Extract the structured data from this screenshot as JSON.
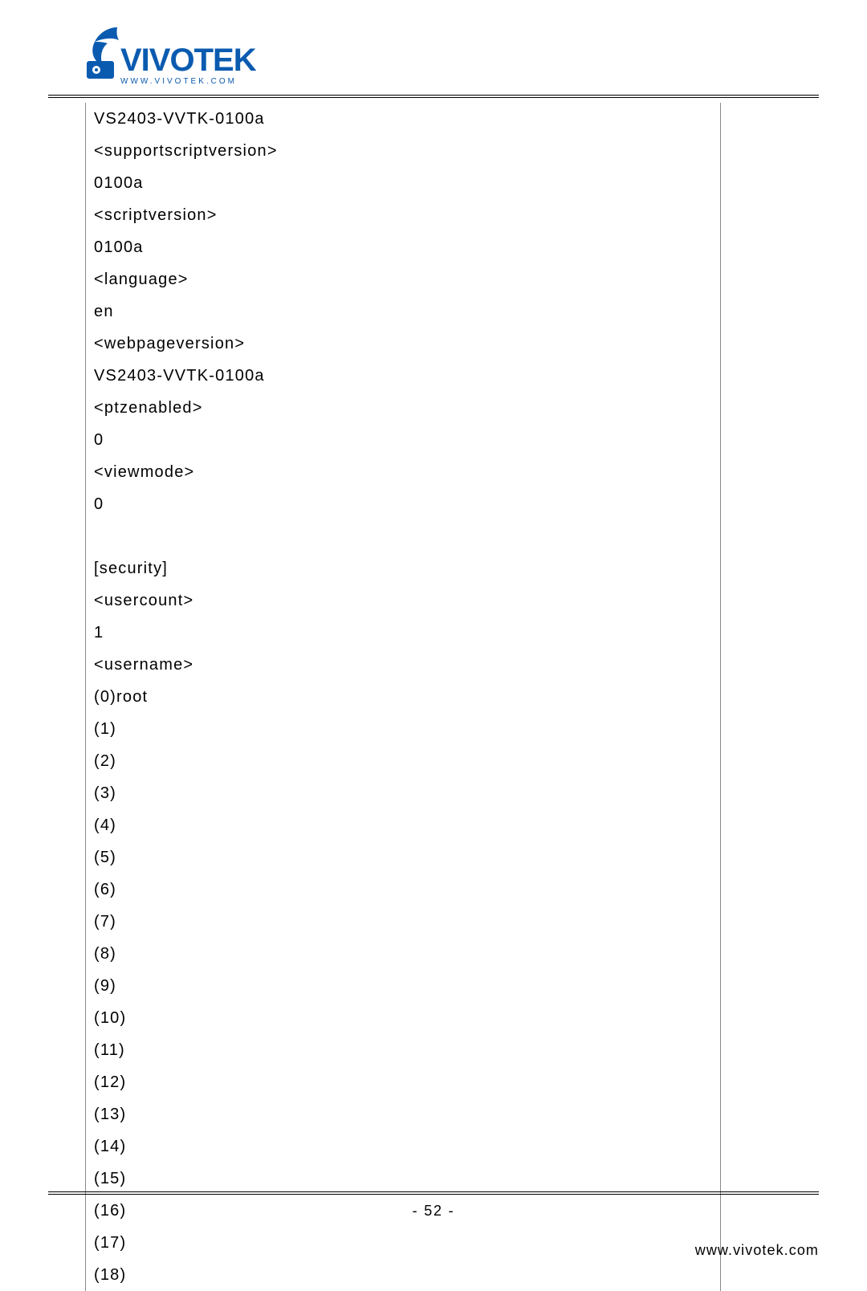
{
  "logo": {
    "brand_text": "VIVOTEK",
    "subtext": "WWW.VIVOTEK.COM"
  },
  "rows": [
    "VS2403-VVTK-0100a",
    "<supportscriptversion>",
    "0100a",
    "<scriptversion>",
    "0100a",
    "<language>",
    "en",
    "<webpageversion>",
    "VS2403-VVTK-0100a",
    "<ptzenabled>",
    "0",
    "<viewmode>",
    "0",
    "",
    "[security]",
    "<usercount>",
    "1",
    "<username>",
    "(0)root",
    "(1)",
    "(2)",
    "(3)",
    "(4)",
    "(5)",
    "(6)",
    "(7)",
    "(8)",
    "(9)",
    "(10)",
    "(11)",
    "(12)",
    "(13)",
    "(14)",
    "(15)",
    "(16)",
    "(17)",
    "(18)"
  ],
  "footer": {
    "page_number": "- 52 -",
    "url": "www.vivotek.com"
  }
}
